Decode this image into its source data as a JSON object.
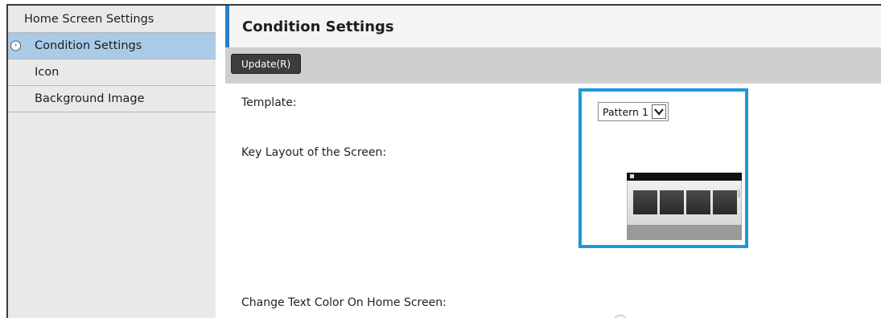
{
  "sidebar": {
    "items": [
      {
        "label": "Home Screen Settings"
      },
      {
        "label": "Condition Settings",
        "active": true
      },
      {
        "label": "Icon"
      },
      {
        "label": "Background Image"
      }
    ]
  },
  "main": {
    "title": "Condition Settings",
    "toolbar": {
      "update_label": "Update(R)"
    },
    "fields": {
      "template_label": "Template:",
      "template_value": "Pattern 1",
      "key_layout_label": "Key Layout of the Screen:",
      "text_color_label": "Change Text Color On Home Screen:"
    }
  },
  "colors": {
    "accent": "#2b7fc4",
    "highlight_border": "#1e98d6",
    "active_item": "#a9cbe8",
    "sidebar_bg": "#e9e9e9",
    "toolbar_bg": "#cfcfcf",
    "button_bg": "#3d3d3d"
  },
  "icons": {
    "active_marker": "arrow-right-circle-icon",
    "select_arrow": "chevron-down-icon"
  }
}
